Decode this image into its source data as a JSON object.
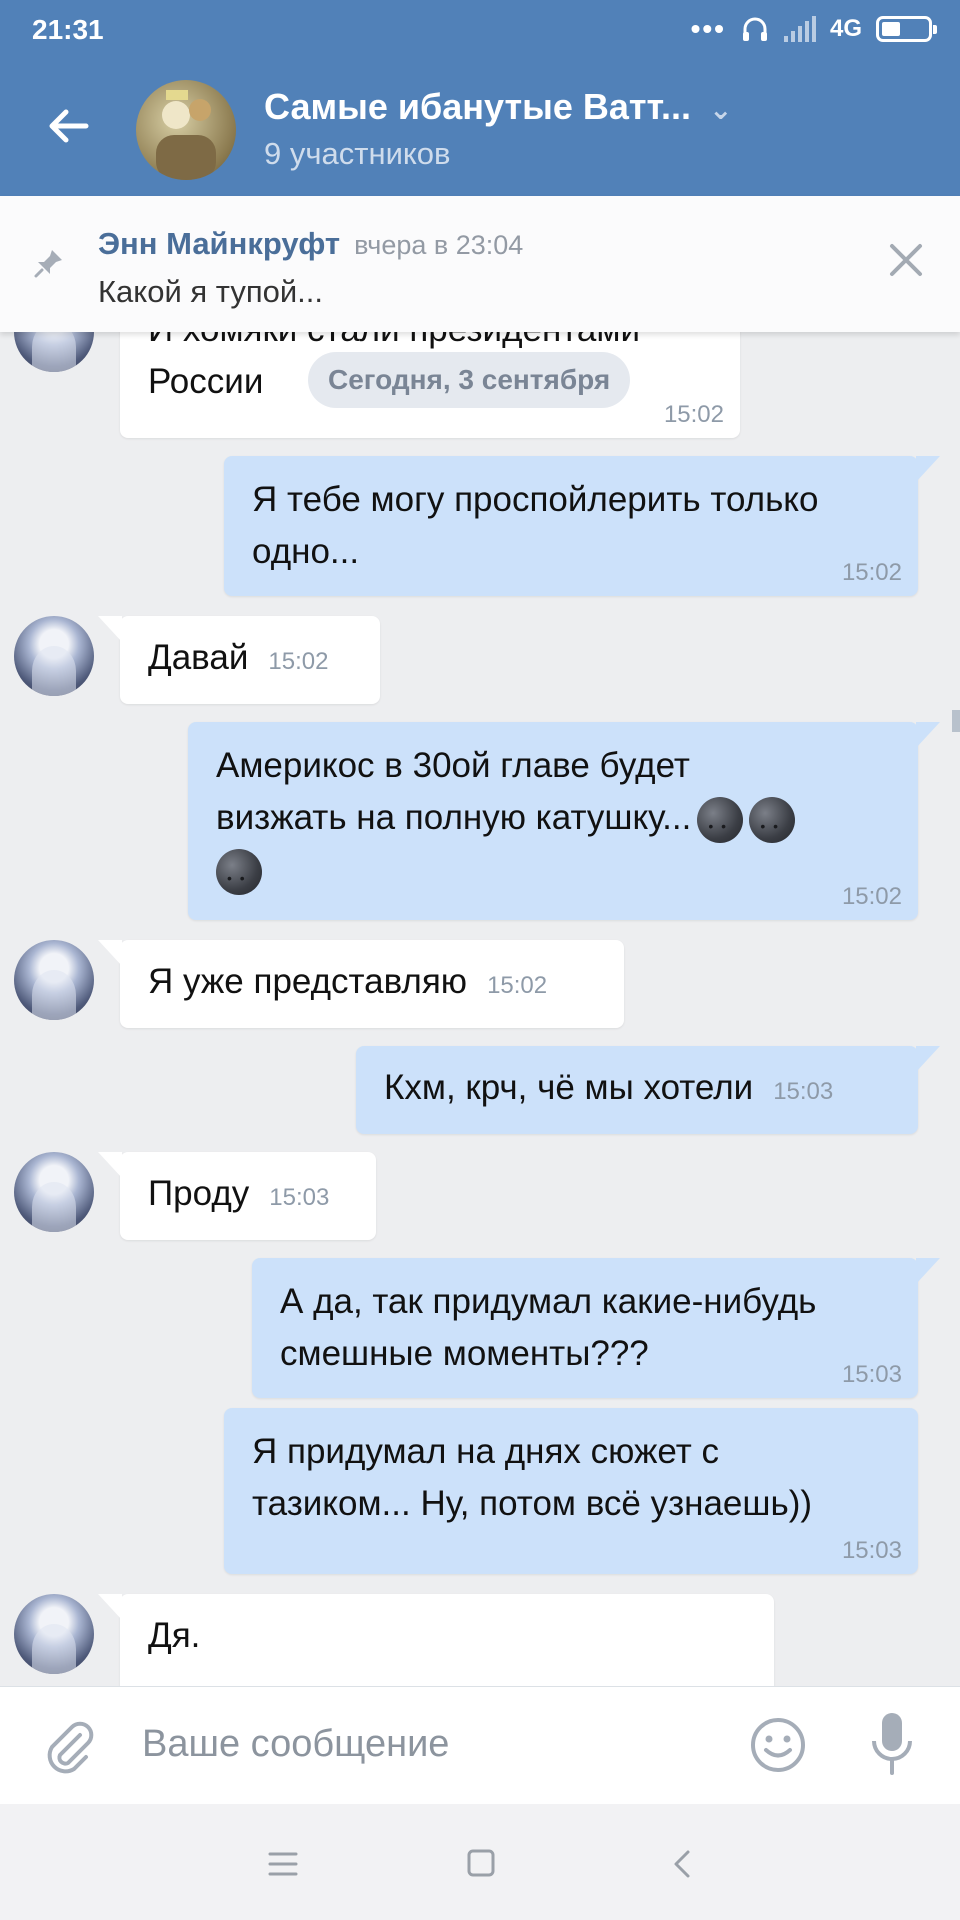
{
  "status_bar": {
    "time": "21:31",
    "network": "4G",
    "icons": [
      "dots-icon",
      "headphones-icon",
      "signal-icon",
      "battery-charging-icon"
    ]
  },
  "header": {
    "title": "Самые ибанутые Ватт...",
    "subtitle": "9 участников",
    "accent_color": "#5181b8"
  },
  "pinned": {
    "author": "Энн Майнкруфт",
    "when": "вчера в 23:04",
    "text": "Какой я тупой..."
  },
  "date_separator": "Сегодня, 3 сентября",
  "messages": [
    {
      "direction": "in",
      "lines": [
        "И хомяки стали президентами",
        "России"
      ],
      "time": "15:02"
    },
    {
      "direction": "out",
      "lines": [
        "Я тебе могу проспойлерить только",
        "одно..."
      ],
      "time": "15:02"
    },
    {
      "direction": "in",
      "lines": [
        "Давай"
      ],
      "time": "15:02"
    },
    {
      "direction": "out",
      "lines": [
        "Америкос в 30ой главе будет",
        "визжать на полную катушку..."
      ],
      "time": "15:02"
    },
    {
      "direction": "in",
      "lines": [
        "Я уже представляю"
      ],
      "time": "15:02"
    },
    {
      "direction": "out",
      "lines": [
        "Кхм, крч, чё мы хотели"
      ],
      "time": "15:03"
    },
    {
      "direction": "in",
      "lines": [
        "Проду"
      ],
      "time": "15:03"
    },
    {
      "direction": "out",
      "lines": [
        "А да, так придумал какие-нибудь",
        "смешные моменты???"
      ],
      "time": "15:03"
    },
    {
      "direction": "out",
      "lines": [
        "Я придумал на днях сюжет с",
        "тазиком... Ну, потом всё узнаешь))"
      ],
      "time": "15:03"
    },
    {
      "direction": "in",
      "lines": [
        "Дя."
      ],
      "time": ""
    }
  ],
  "composer": {
    "placeholder": "Ваше сообщение"
  }
}
